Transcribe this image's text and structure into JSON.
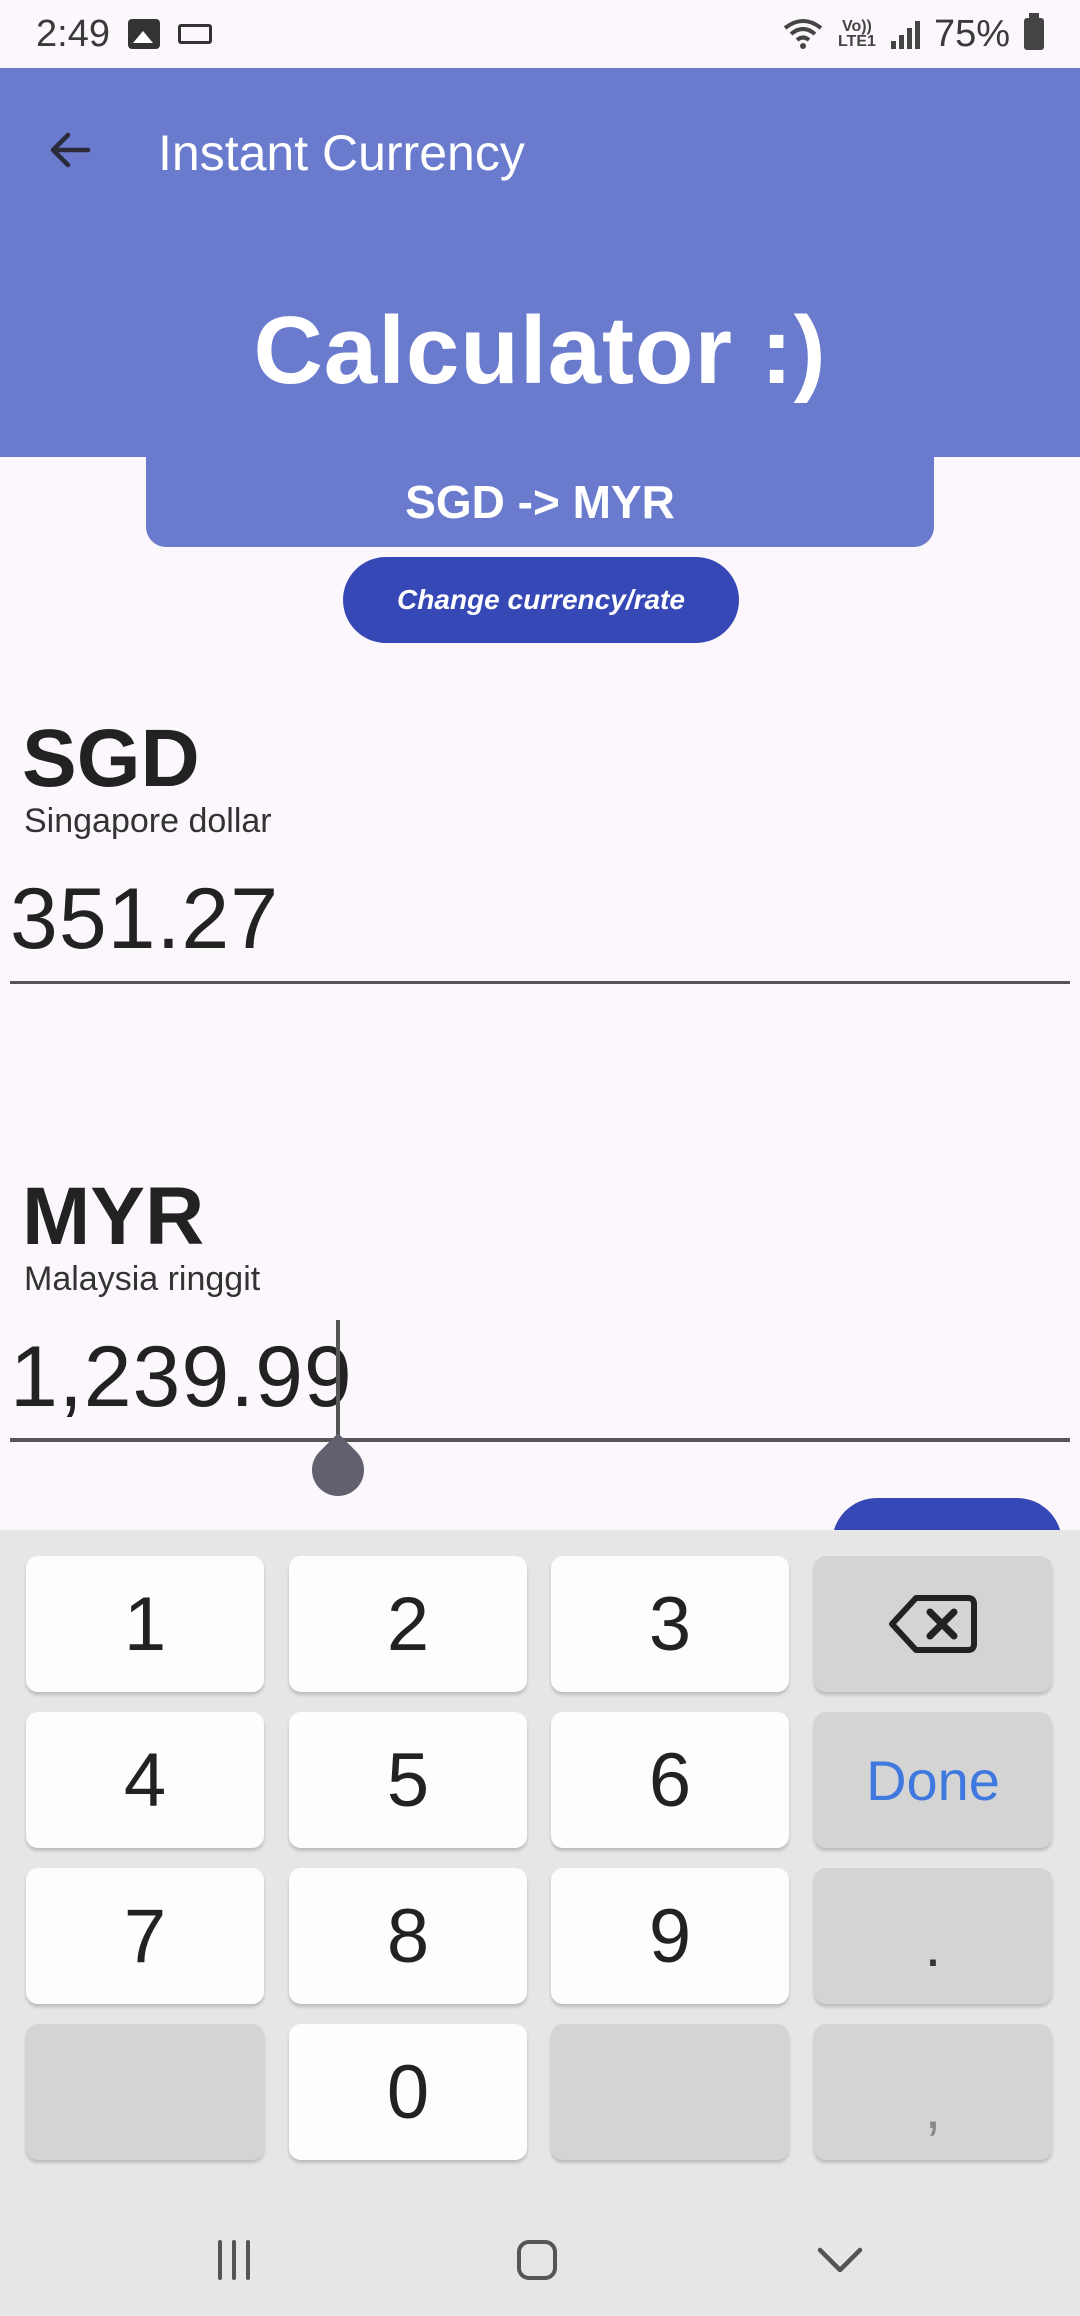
{
  "status_bar": {
    "time": "2:49",
    "battery": "75%",
    "network_label": "Vo)) LTE1"
  },
  "app_bar": {
    "title": "Instant Currency",
    "hero": "Calculator :)"
  },
  "pair": {
    "label": "SGD -> MYR"
  },
  "change_button": {
    "label": "Change currency/rate"
  },
  "from": {
    "code": "SGD",
    "name": "Singapore dollar",
    "value": "351.27"
  },
  "to": {
    "code": "MYR",
    "name": "Malaysia ringgit",
    "value": "1,239.99"
  },
  "keypad": {
    "keys": [
      "1",
      "2",
      "3",
      "4",
      "5",
      "6",
      "Done",
      "7",
      "8",
      "9",
      ".",
      "0",
      ","
    ]
  },
  "colors": {
    "header": "#6a7bce",
    "button": "#3647b6",
    "done": "#3f78de",
    "background": "#fcf7fc"
  },
  "icons": [
    "back-arrow-icon",
    "gallery-icon",
    "keyboard-icon",
    "wifi-icon",
    "signal-icon",
    "battery-icon",
    "backspace-icon",
    "recent-apps-icon",
    "home-icon",
    "nav-down-icon"
  ]
}
